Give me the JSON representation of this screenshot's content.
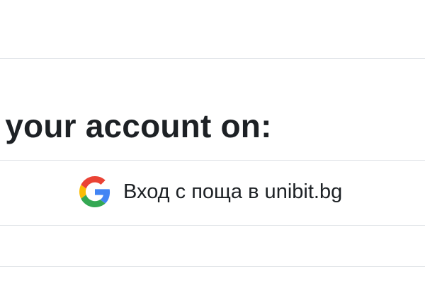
{
  "login_section": {
    "heading": "g your account on:",
    "providers": [
      {
        "icon": "google-icon",
        "label": "Вход с поща в unibit.bg",
        "colors": {
          "blue": "#4285F4",
          "red": "#EA4335",
          "yellow": "#FBBC05",
          "green": "#34A853"
        }
      }
    ]
  },
  "theme": {
    "text": "#1d2125",
    "divider": "#dee2e6",
    "background": "#ffffff"
  }
}
